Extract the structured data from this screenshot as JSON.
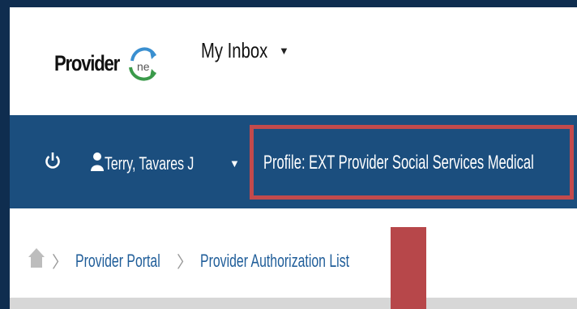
{
  "header": {
    "logo": {
      "text": "ProviderOne",
      "icon": "providerone-logo"
    },
    "inbox_label": "My Inbox",
    "inbox_caret": "▼"
  },
  "navbar": {
    "user_name": "Terry, Tavares J",
    "user_caret": "▼",
    "profile_label": "Profile: EXT Provider Social Services Medical",
    "highlight_color": "#c24a4c",
    "background_color": "#1b4e7e"
  },
  "breadcrumb": {
    "items": [
      {
        "label": "Provider Portal"
      },
      {
        "label": "Provider Authorization List"
      }
    ],
    "separator": "〉"
  },
  "annotation": {
    "color": "#b7474a"
  }
}
